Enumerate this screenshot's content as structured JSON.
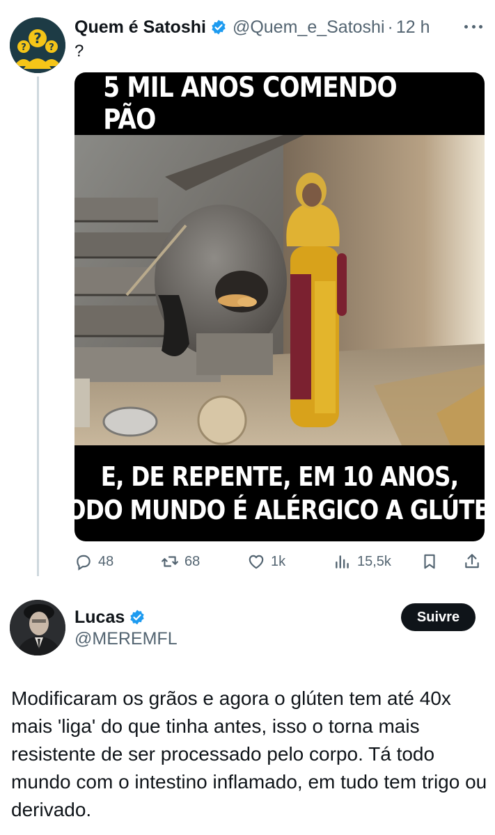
{
  "parent_tweet": {
    "author_name": "Quem é Satoshi",
    "handle": "@Quem_e_Satoshi",
    "separator": "·",
    "time": "12 h",
    "text": "?",
    "verified": true,
    "avatar_icon": "question-people-icon",
    "meme": {
      "top_caption": "5 MIL ANOS COMENDO PÃO",
      "bottom_caption_line1": "E, DE REPENTE, EM 10 ANOS,",
      "bottom_caption_line2": "TODO MUNDO É ALÉRGICO A GLÚTEN"
    },
    "stats": {
      "replies": "48",
      "reposts": "68",
      "likes": "1k",
      "views": "15,5k"
    }
  },
  "reply_tweet": {
    "author_name": "Lucas",
    "handle": "@MEREMFL",
    "verified": true,
    "follow_label": "Suivre",
    "text": "Modificaram os grãos e agora o glúten tem até 40x mais 'liga' do que tinha antes, isso o torna mais resistente de ser processado pelo corpo. Tá todo mundo com o intestino inflamado, em tudo tem trigo ou derivado."
  },
  "colors": {
    "verified_blue": "#1d9bf0",
    "secondary_text": "#536471",
    "primary_text": "#0f1419",
    "follow_button_bg": "#0f1419",
    "thread_line": "#cfd9de"
  }
}
